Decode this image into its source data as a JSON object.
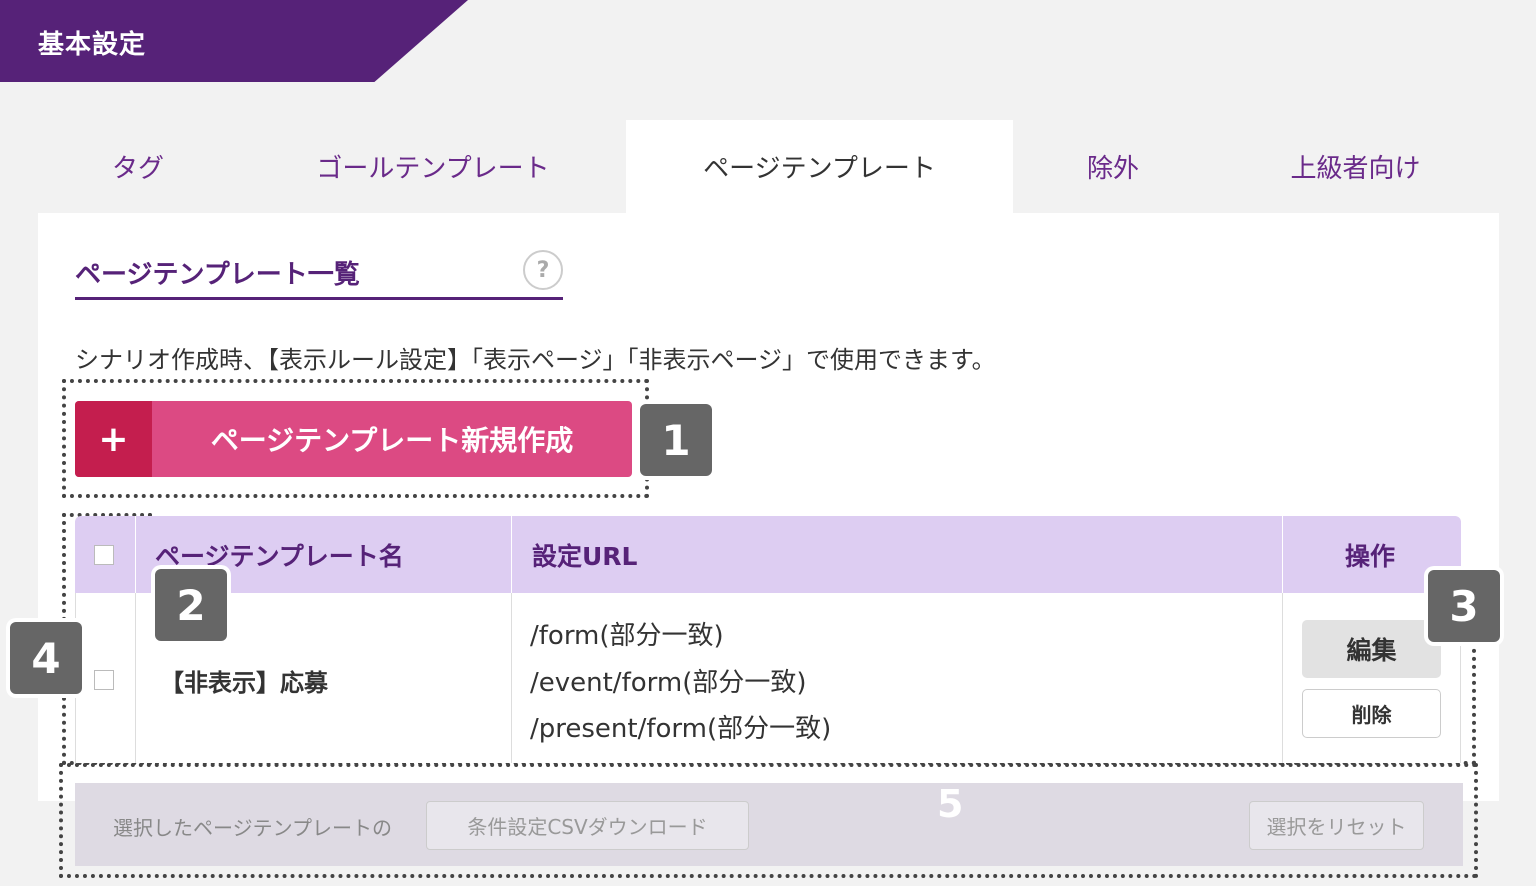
{
  "header": {
    "title": "基本設定"
  },
  "tabs": [
    {
      "label": "タグ",
      "active": false
    },
    {
      "label": "ゴールテンプレート",
      "active": false
    },
    {
      "label": "ページテンプレート",
      "active": true
    },
    {
      "label": "除外",
      "active": false
    },
    {
      "label": "上級者向け",
      "active": false
    }
  ],
  "section": {
    "title": "ページテンプレート一覧",
    "help_icon": "question-mark",
    "description": "シナリオ作成時、【表示ルール設定】「表示ページ」「非表示ページ」で使用できます。"
  },
  "new_button": {
    "plus": "+",
    "label": "ページテンプレート新規作成"
  },
  "table": {
    "headers": [
      "ページテンプレート名",
      "設定URL",
      "操作"
    ],
    "rows": [
      {
        "name": "【非表示】応募",
        "urls": [
          "/form(部分一致)",
          "/event/form(部分一致)",
          "/present/form(部分一致)"
        ],
        "actions": {
          "edit": "編集",
          "delete": "削除"
        }
      }
    ]
  },
  "footer": {
    "label": "選択したページテンプレートの",
    "csv_button": "条件設定CSVダウンロード",
    "reset_button": "選択をリセット"
  },
  "annotations": [
    "1",
    "2",
    "3",
    "4",
    "5"
  ],
  "colors": {
    "brand": "#562278",
    "accent": "#dc4a83",
    "accent_dark": "#c41e4e",
    "header_bg": "#ddcdf2"
  }
}
